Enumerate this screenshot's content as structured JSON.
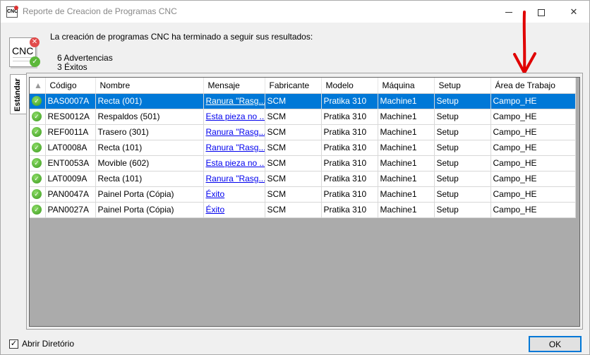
{
  "window": {
    "title": "Reporte de Creacion de Programas CNC",
    "app_icon_text": "CNC"
  },
  "header": {
    "icon_text": "CNC",
    "message": "La creación de programas CNC ha terminado a seguir sus resultados:",
    "warnings": "6 Advertencias",
    "successes": "3 Éxitos"
  },
  "tab": {
    "label": "Estándar"
  },
  "table": {
    "columns": [
      "Código",
      "Nombre",
      "Mensaje",
      "Fabricante",
      "Modelo",
      "Máquina",
      "Setup",
      "Área de Trabajo"
    ],
    "rows": [
      {
        "status": "success-icon",
        "codigo": "BAS0007A",
        "nombre": "Recta (001)",
        "mensaje": "Ranura \"Rasg...",
        "fabricante": "SCM",
        "modelo": "Pratika 310",
        "maquina": "Machine1",
        "setup": "Setup",
        "area": "Campo_HE"
      },
      {
        "status": "success-icon",
        "codigo": "RES0012A",
        "nombre": "Respaldos (501)",
        "mensaje": "Esta pieza no ...",
        "fabricante": "SCM",
        "modelo": "Pratika 310",
        "maquina": "Machine1",
        "setup": "Setup",
        "area": "Campo_HE"
      },
      {
        "status": "success-icon",
        "codigo": "REF0011A",
        "nombre": "Trasero (301)",
        "mensaje": "Ranura \"Rasg...",
        "fabricante": "SCM",
        "modelo": "Pratika 310",
        "maquina": "Machine1",
        "setup": "Setup",
        "area": "Campo_HE"
      },
      {
        "status": "success-icon",
        "codigo": "LAT0008A",
        "nombre": "Recta (101)",
        "mensaje": "Ranura \"Rasg...",
        "fabricante": "SCM",
        "modelo": "Pratika 310",
        "maquina": "Machine1",
        "setup": "Setup",
        "area": "Campo_HE"
      },
      {
        "status": "success-icon",
        "codigo": "ENT0053A",
        "nombre": "Movible (602)",
        "mensaje": "Esta pieza no ...",
        "fabricante": "SCM",
        "modelo": "Pratika 310",
        "maquina": "Machine1",
        "setup": "Setup",
        "area": "Campo_HE"
      },
      {
        "status": "success-icon",
        "codigo": "LAT0009A",
        "nombre": "Recta (101)",
        "mensaje": "Ranura \"Rasg...",
        "fabricante": "SCM",
        "modelo": "Pratika 310",
        "maquina": "Machine1",
        "setup": "Setup",
        "area": "Campo_HE"
      },
      {
        "status": "success-icon",
        "codigo": "PAN0047A",
        "nombre": "Painel Porta (Cópia)",
        "mensaje": "Éxito",
        "fabricante": "SCM",
        "modelo": "Pratika 310",
        "maquina": "Machine1",
        "setup": "Setup",
        "area": "Campo_HE"
      },
      {
        "status": "success-icon",
        "codigo": "PAN0027A",
        "nombre": "Painel Porta (Cópia)",
        "mensaje": "Éxito",
        "fabricante": "SCM",
        "modelo": "Pratika 310",
        "maquina": "Machine1",
        "setup": "Setup",
        "area": "Campo_HE"
      }
    ],
    "selected_row": 0
  },
  "footer": {
    "checkbox_label": "Abrir Diretório",
    "checkbox_checked": true,
    "ok_label": "OK"
  },
  "colors": {
    "selection": "#0078d7",
    "link": "#0000ee",
    "annotation_arrow": "#e00000",
    "success": "#4caf2a",
    "error": "#e14b4b"
  }
}
